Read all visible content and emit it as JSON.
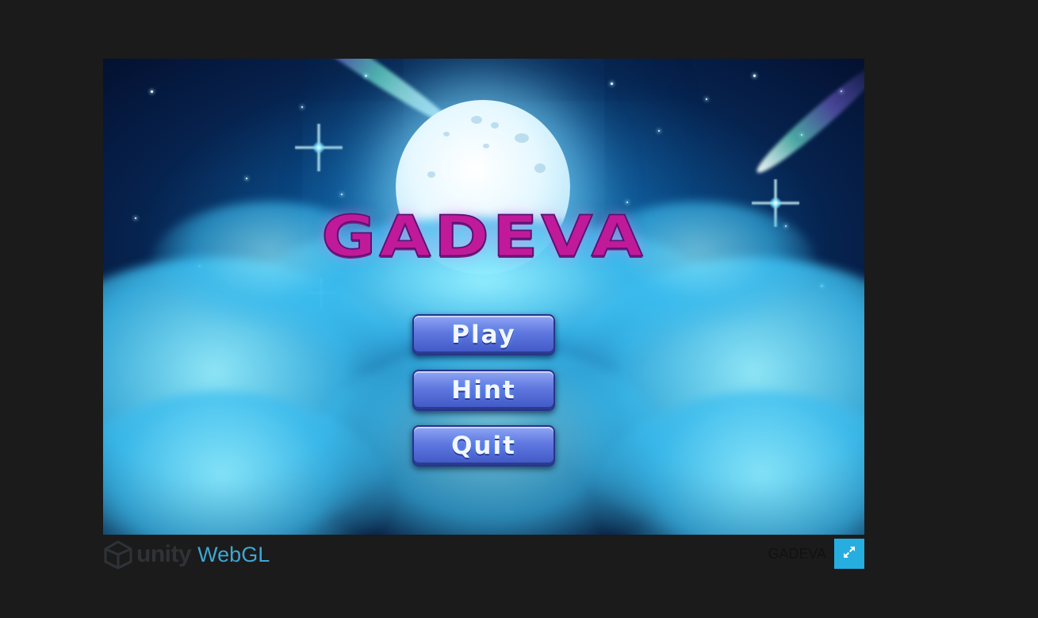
{
  "game": {
    "title": "GADEVA",
    "menu": {
      "play_label": "Play",
      "hint_label": "Hint",
      "quit_label": "Quit"
    }
  },
  "footer": {
    "unity_text": "unity",
    "webgl_text": "WebGL",
    "build_title": "GADEVA",
    "fullscreen_icon": "fullscreen-icon"
  },
  "colors": {
    "page_background": "#1b1b1b",
    "title_magenta": "#c01a9a",
    "button_blue": "#5f77df",
    "webgl_blue": "#3fa6d3",
    "fullscreen_button": "#26aee0"
  }
}
